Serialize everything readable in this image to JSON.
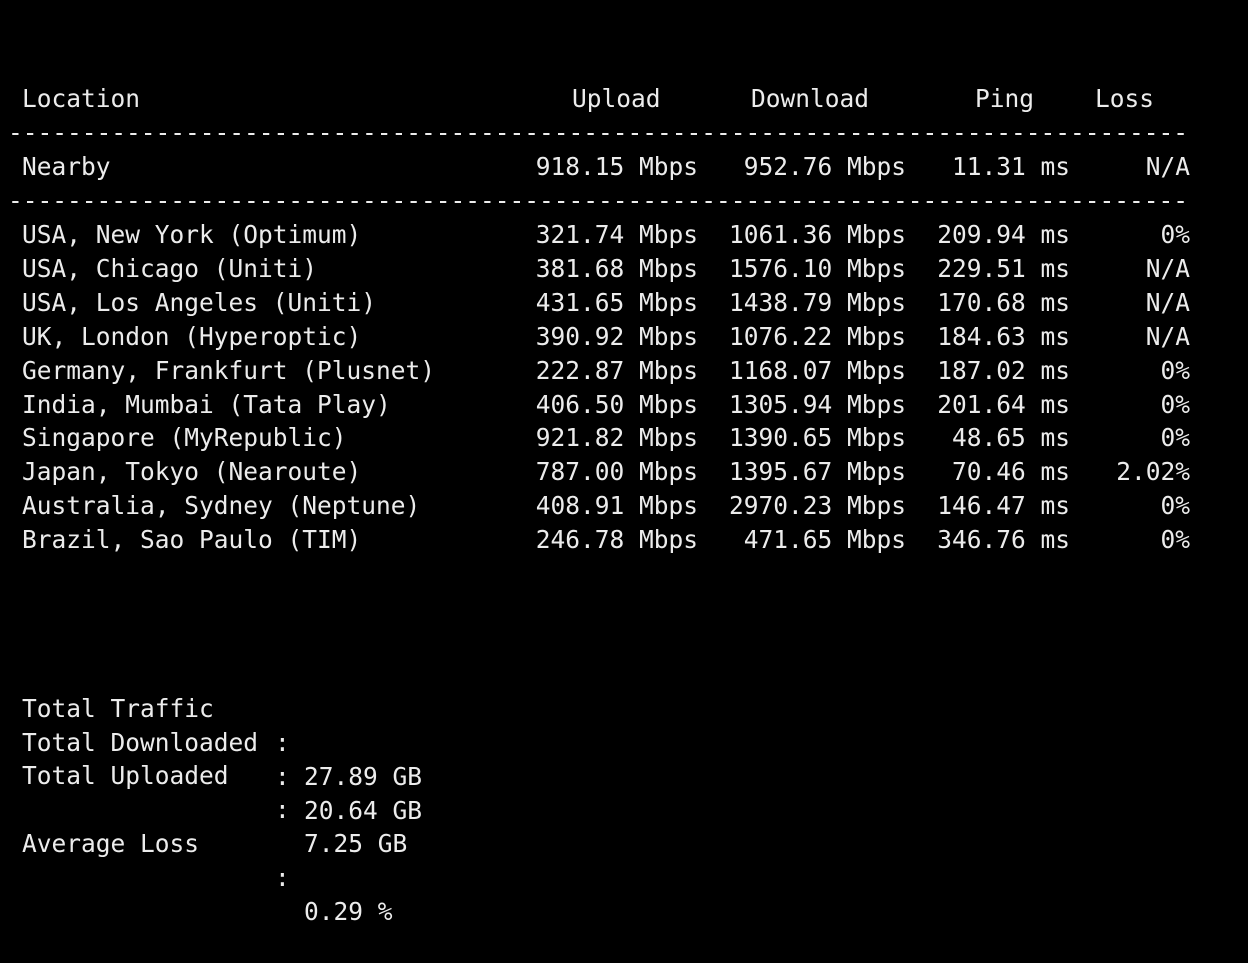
{
  "header": {
    "location": "Location",
    "upload": "Upload",
    "download": "Download",
    "ping": "Ping",
    "loss": "Loss"
  },
  "divider": "---------------------------------------------------------------------------------------------",
  "nearby": {
    "location": "Nearby",
    "upload": "918.15 Mbps",
    "download": "952.76 Mbps",
    "ping": "11.31 ms",
    "loss": "N/A"
  },
  "rows": [
    {
      "location": "USA, New York (Optimum)",
      "upload": "321.74 Mbps",
      "download": "1061.36 Mbps",
      "ping": "209.94 ms",
      "loss": "0%"
    },
    {
      "location": "USA, Chicago (Uniti)",
      "upload": "381.68 Mbps",
      "download": "1576.10 Mbps",
      "ping": "229.51 ms",
      "loss": "N/A"
    },
    {
      "location": "USA, Los Angeles (Uniti)",
      "upload": "431.65 Mbps",
      "download": "1438.79 Mbps",
      "ping": "170.68 ms",
      "loss": "N/A"
    },
    {
      "location": "UK, London (Hyperoptic)",
      "upload": "390.92 Mbps",
      "download": "1076.22 Mbps",
      "ping": "184.63 ms",
      "loss": "N/A"
    },
    {
      "location": "Germany, Frankfurt (Plusnet)",
      "upload": "222.87 Mbps",
      "download": "1168.07 Mbps",
      "ping": "187.02 ms",
      "loss": "0%"
    },
    {
      "location": "India, Mumbai (Tata Play)",
      "upload": "406.50 Mbps",
      "download": "1305.94 Mbps",
      "ping": "201.64 ms",
      "loss": "0%"
    },
    {
      "location": "Singapore (MyRepublic)",
      "upload": "921.82 Mbps",
      "download": "1390.65 Mbps",
      "ping": "48.65 ms",
      "loss": "0%"
    },
    {
      "location": "Japan, Tokyo (Nearoute)",
      "upload": "787.00 Mbps",
      "download": "1395.67 Mbps",
      "ping": "70.46 ms",
      "loss": "2.02%"
    },
    {
      "location": "Australia, Sydney (Neptune)",
      "upload": "408.91 Mbps",
      "download": "2970.23 Mbps",
      "ping": "146.47 ms",
      "loss": "0%"
    },
    {
      "location": "Brazil, Sao Paulo (TIM)",
      "upload": "246.78 Mbps",
      "download": "471.65 Mbps",
      "ping": "346.76 ms",
      "loss": "0%"
    }
  ],
  "summary": {
    "total_traffic_label": "Total Traffic",
    "total_traffic_value": "27.89 GB",
    "total_downloaded_label": "Total Downloaded",
    "total_downloaded_value": "20.64 GB",
    "total_uploaded_label": "Total Uploaded",
    "total_uploaded_value": "7.25 GB",
    "average_loss_label": "Average Loss",
    "average_loss_value": "0.29 %",
    "separator": ":"
  },
  "colors": {
    "background": "#000000",
    "text": "#ececec"
  }
}
